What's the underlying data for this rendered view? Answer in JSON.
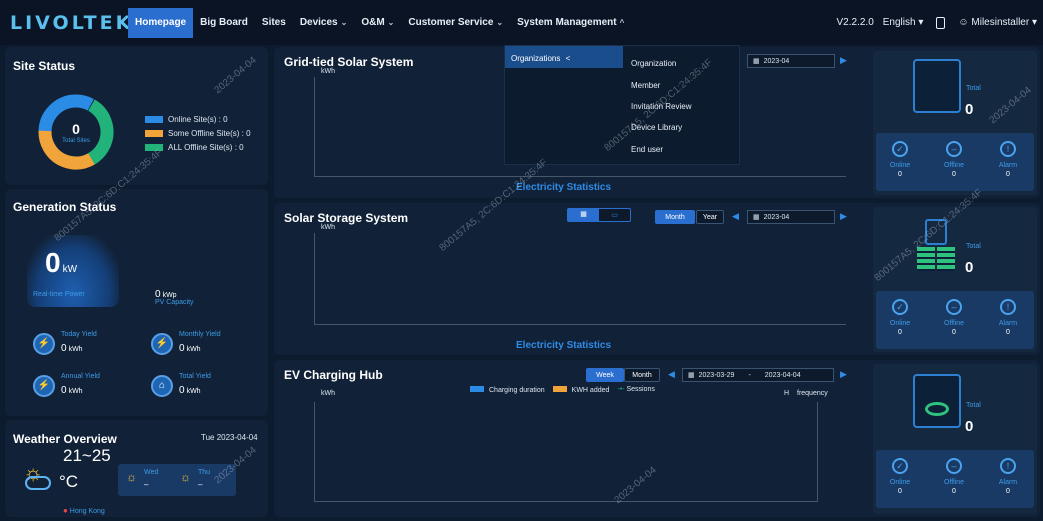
{
  "header": {
    "logo": "LIVOLTEK",
    "nav": [
      {
        "label": "Homepage",
        "active": true,
        "chevron": ""
      },
      {
        "label": "Big Board",
        "chevron": ""
      },
      {
        "label": "Sites",
        "chevron": ""
      },
      {
        "label": "Devices",
        "chevron": "⌄"
      },
      {
        "label": "O&M",
        "chevron": "⌄"
      },
      {
        "label": "Customer Service",
        "chevron": "⌄"
      },
      {
        "label": "System Management",
        "chevron": "^"
      }
    ],
    "version": "V2.2.2.0",
    "language": "English",
    "username": "Milesinstaller"
  },
  "dropdown": {
    "left_label": "Organizations",
    "left_chevron": "<",
    "items": [
      "Organization",
      "Member",
      "Invitation Review",
      "Device Library",
      "End user"
    ]
  },
  "site_status": {
    "title": "Site Status",
    "donut_value": "0",
    "donut_label": "Total Sites",
    "legend": [
      {
        "label": "Online Site(s) : 0",
        "color": "#2b8ce6"
      },
      {
        "label": "Some Offline Site(s) : 0",
        "color": "#f0a43a"
      },
      {
        "label": "ALL Offline Site(s) : 0",
        "color": "#22b37a"
      }
    ]
  },
  "generation": {
    "title": "Generation Status",
    "power_value": "0",
    "power_unit": "kW",
    "power_label": "Real-time Power",
    "capacity_value": "0",
    "capacity_unit": "kWp",
    "capacity_label": "PV Capacity",
    "yields": [
      {
        "label": "Today Yield",
        "value": "0",
        "unit": "kWh"
      },
      {
        "label": "Monthly Yield",
        "value": "0",
        "unit": "kWh"
      },
      {
        "label": "Annual Yield",
        "value": "0",
        "unit": "kWh"
      },
      {
        "label": "Total Yield",
        "value": "0",
        "unit": "kWh"
      }
    ]
  },
  "weather": {
    "title": "Weather Overview",
    "date": "Tue 2023-04-04",
    "temp": "21~25",
    "unit": "°C",
    "forecast": [
      {
        "day": "Wed",
        "temp": "–"
      },
      {
        "day": "Thu",
        "temp": "–"
      }
    ],
    "location": "Hong Kong"
  },
  "grid_tied": {
    "title": "Grid-tied Solar System",
    "unit": "kWh",
    "chart_label": "Electricity Statistics",
    "date": "2023-04",
    "total_label": "Total",
    "total_value": "0",
    "stats": [
      {
        "label": "Online",
        "value": "0"
      },
      {
        "label": "Offline",
        "value": "0"
      },
      {
        "label": "Alarm",
        "value": "0"
      }
    ]
  },
  "storage": {
    "title": "Solar Storage System",
    "unit": "kWh",
    "chart_label": "Electricity Statistics",
    "tabs": [
      "Month",
      "Year"
    ],
    "date": "2023-04",
    "total_label": "Total",
    "total_value": "0",
    "stats": [
      {
        "label": "Online",
        "value": "0"
      },
      {
        "label": "Offline",
        "value": "0"
      },
      {
        "label": "Alarm",
        "value": "0"
      }
    ]
  },
  "ev": {
    "title": "EV Charging Hub",
    "unit": "kWh",
    "unit_right": "H",
    "frequency": "frequency",
    "tabs": [
      "Week",
      "Month"
    ],
    "date_from": "2023-03-29",
    "date_to": "2023-04-04",
    "legend": [
      {
        "label": "Charging duration",
        "color": "#2b8ce6"
      },
      {
        "label": "KWH added",
        "color": "#f0a43a"
      },
      {
        "label": "Sessions",
        "color": "#22b37a"
      }
    ],
    "total_label": "Total",
    "total_value": "0",
    "stats": [
      {
        "label": "Online",
        "value": "0"
      },
      {
        "label": "Offline",
        "value": "0"
      },
      {
        "label": "Alarm",
        "value": "0"
      }
    ]
  },
  "watermarks": [
    "2023-04-04",
    "800157A5, 2C:6D:C1:24:35:4F",
    "2023-04-04",
    "800157A5, 2C:6D:C1:24:35:4F",
    "800157A5, 2C:6D:C1:24:35:4F",
    "800157A5, 2C:6D:C1:24:35:4F",
    "2023-04-04",
    "2023-04-04"
  ]
}
